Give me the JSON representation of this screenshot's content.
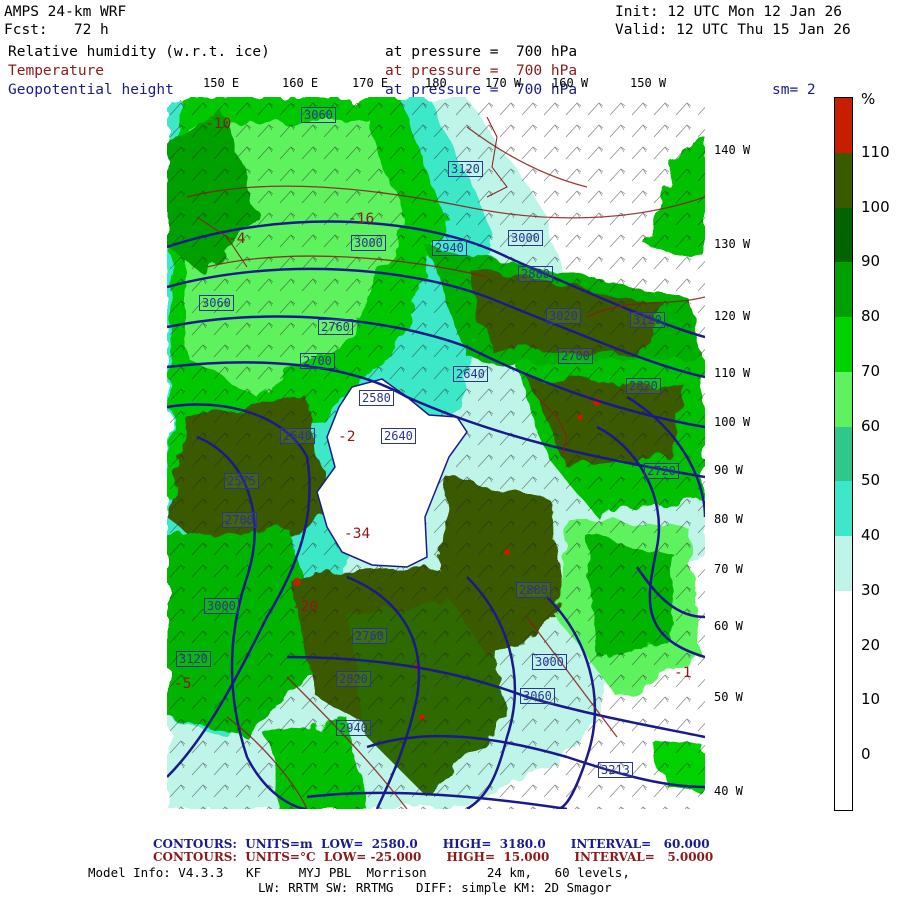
{
  "header": {
    "model": "AMPS 24-km WRF",
    "init": "Init: 12 UTC Mon 12 Jan 26",
    "fcst": "Fcst:   72 h",
    "valid": "Valid: 12 UTC Thu 15 Jan 26"
  },
  "fields": [
    {
      "name": "Relative humidity (w.r.t. ice)",
      "level": "at pressure =  700 hPa",
      "color": "#000000"
    },
    {
      "name": "Temperature",
      "level": "at pressure =  700 hPa",
      "color": "#8b1a1a"
    },
    {
      "name": "Geopotential height",
      "level": "at pressure =  700 hPa",
      "color": "#1a1a8c"
    }
  ],
  "smoothing": "sm= 2",
  "map": {
    "lon_labels_top": [
      "150 E",
      "160 E",
      "170 E",
      "180",
      "170 W",
      "160 W",
      "150 W"
    ],
    "lat_labels_right": [
      "140 W",
      "130 W",
      "120 W",
      "110 W",
      "100 W",
      "90 W",
      "80 W",
      "70 W",
      "60 W",
      "50 W",
      "40 W"
    ],
    "height_boxes": [
      "3060",
      "3120",
      "3000",
      "2940",
      "3000",
      "3060",
      "2880",
      "2760",
      "2700",
      "2640",
      "3020",
      "2820",
      "3120",
      "2580",
      "2640",
      "2700",
      "2575",
      "2700",
      "2640",
      "3000",
      "2760",
      "2820",
      "2940",
      "3060",
      "3000",
      "3120",
      "2880",
      "3213",
      "2720"
    ],
    "temp_labels": [
      "-10",
      "-16",
      "-4",
      "-2",
      "-34",
      "-20",
      "-5",
      "-1"
    ]
  },
  "colorbar": {
    "unit": "%",
    "labels": [
      "110",
      "100",
      "90",
      "80",
      "70",
      "60",
      "50",
      "40",
      "30",
      "20",
      "10",
      "0"
    ],
    "colors": [
      "#c81e00",
      "#3a5a00",
      "#006400",
      "#00a000",
      "#00d200",
      "#5ef25e",
      "#2fc78c",
      "#3de8c8",
      "#bff5e8",
      "#ffffff",
      "#ffffff",
      "#ffffff",
      "#ffffff"
    ]
  },
  "footer": {
    "contours_height": {
      "label": "CONTOURS:",
      "units": "UNITS=m",
      "low": "LOW=  2580.0",
      "high": "HIGH=  3180.0",
      "interval": "INTERVAL=   60.000"
    },
    "contours_temp": {
      "label": "CONTOURS:",
      "units": "UNITS=°C",
      "low": "LOW= -25.000",
      "high": "HIGH=  15.000",
      "interval": "INTERVAL=   5.0000"
    },
    "model_info_1": "Model Info: V4.3.3   KF     MYJ PBL  Morrison        24 km,   60 levels,",
    "model_info_2": "LW: RRTM SW: RRTMG   DIFF: simple KM: 2D Smagor"
  }
}
